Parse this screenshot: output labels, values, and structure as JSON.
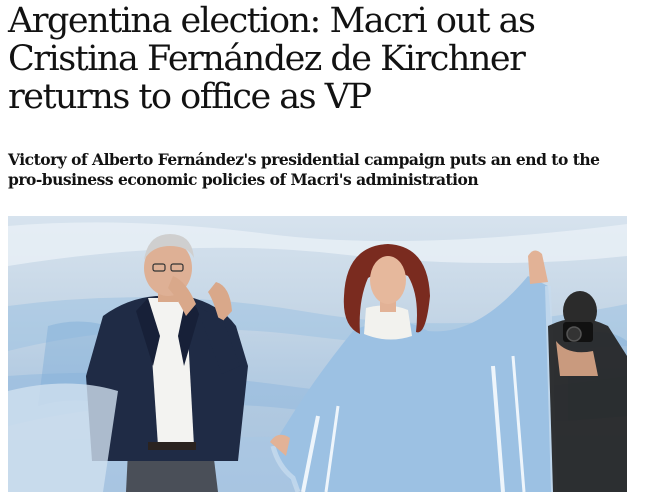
{
  "article": {
    "headline": "Argentina election: Macri out as Cristina Fernández de Kirchner returns to office as VP",
    "standfirst": "Victory of Alberto Fernández's presidential campaign puts an end to the pro-business economic policies of Macri's administration"
  },
  "photo": {
    "subjects": [
      "man-in-suit-applauding",
      "woman-in-blue-poncho-waving",
      "photographer-with-camera"
    ],
    "colors": {
      "sky": "#c5d6e6",
      "flag_blue": "#8fb8dd",
      "poncho": "#9cc1e3",
      "suit": "#1f2b45"
    }
  }
}
